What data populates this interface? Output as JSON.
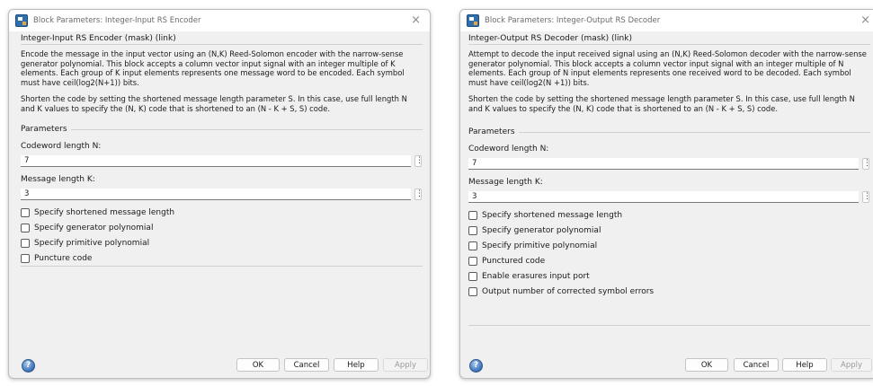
{
  "encoder": {
    "title": "Block Parameters: Integer-Input RS Encoder",
    "subtitle": "Integer-Input RS Encoder (mask) (link)",
    "desc1": "Encode the message in the input vector using an (N,K) Reed-Solomon encoder with the narrow-sense generator polynomial.  This block accepts a column vector input signal with an integer multiple of K elements.  Each group of K input elements represents one message word to be encoded.  Each symbol must have ceil(log2(N+1)) bits.",
    "desc2": "Shorten the code by setting the shortened message length parameter S. In this case, use full length N and K values to specify the (N, K) code that is shortened to an (N - K + S, S) code.",
    "params_label": "Parameters",
    "codeword_label": "Codeword length N:",
    "codeword_value": "7",
    "message_label": "Message length K:",
    "message_value": "3",
    "checkboxes": [
      "Specify shortened message length",
      "Specify generator polynomial",
      "Specify primitive polynomial",
      "Puncture code"
    ],
    "buttons": {
      "ok": "OK",
      "cancel": "Cancel",
      "help": "Help",
      "apply": "Apply"
    }
  },
  "decoder": {
    "title": "Block Parameters: Integer-Output RS Decoder",
    "subtitle": "Integer-Output RS Decoder (mask) (link)",
    "desc1": "Attempt to decode the input received signal using an (N,K) Reed-Solomon decoder with the narrow-sense generator polynomial.  This block accepts a column vector input signal with an integer multiple of N elements. Each group of N input elements represents one received word to be decoded.  Each symbol must have ceil(log2(N +1)) bits.",
    "desc2": "Shorten the code by setting the shortened message length parameter S. In this case, use full length N and K values to specify the (N, K) code that is shortened to an (N - K + S, S) code.",
    "params_label": "Parameters",
    "codeword_label": "Codeword length N:",
    "codeword_value": "7",
    "message_label": "Message length K:",
    "message_value": "3",
    "checkboxes": [
      "Specify shortened message length",
      "Specify generator polynomial",
      "Specify primitive polynomial",
      "Punctured code",
      "Enable erasures input port",
      "Output number of corrected symbol errors"
    ],
    "buttons": {
      "ok": "OK",
      "cancel": "Cancel",
      "help": "Help",
      "apply": "Apply"
    }
  },
  "icons": {
    "close": "×",
    "help": "?",
    "kebab": "⋮"
  }
}
